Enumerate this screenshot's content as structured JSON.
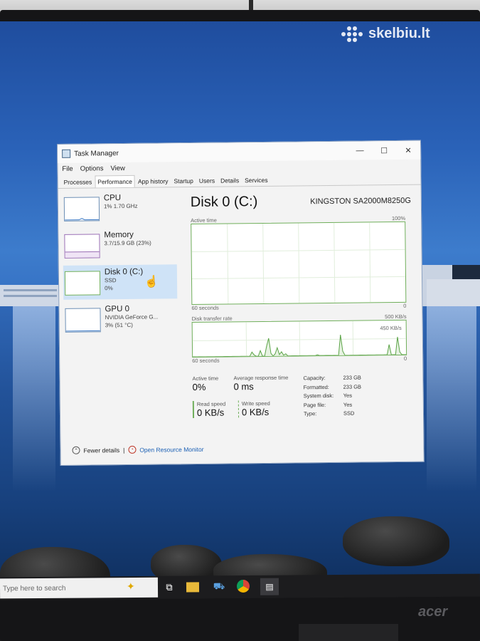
{
  "watermark": "skelbiu.lt",
  "window": {
    "title": "Task Manager",
    "controls": {
      "minimize": "—",
      "maximize": "☐",
      "close": "✕"
    },
    "menu": [
      "File",
      "Options",
      "View"
    ],
    "tabs": [
      "Processes",
      "Performance",
      "App history",
      "Startup",
      "Users",
      "Details",
      "Services"
    ],
    "active_tab": "Performance"
  },
  "resources": [
    {
      "name": "CPU",
      "line1": "1% 1.70 GHz",
      "line2": ""
    },
    {
      "name": "Memory",
      "line1": "3.7/15.9 GB (23%)",
      "line2": ""
    },
    {
      "name": "Disk 0 (C:)",
      "line1": "SSD",
      "line2": "0%"
    },
    {
      "name": "GPU 0",
      "line1": "NVIDIA GeForce G...",
      "line2": "3% (51 °C)"
    }
  ],
  "detail": {
    "title": "Disk 0 (C:)",
    "model": "KINGSTON SA2000M8250G",
    "active_time_graph": {
      "label": "Active time",
      "max": "100%",
      "time_left": "60 seconds",
      "min": "0"
    },
    "transfer_graph": {
      "label": "Disk transfer rate",
      "max": "500 KB/s",
      "marker": "450 KB/s",
      "time_left": "60 seconds",
      "min": "0",
      "rates_kbps": [
        0,
        0,
        0,
        0,
        0,
        0,
        0,
        0,
        0,
        0,
        0,
        0,
        0,
        0,
        0,
        0,
        0,
        0,
        0,
        0,
        0,
        0,
        0,
        0,
        0,
        0,
        0,
        0,
        60,
        20,
        0,
        0,
        80,
        0,
        0,
        150,
        260,
        40,
        0,
        30,
        120,
        20,
        60,
        10,
        30,
        0,
        0,
        0,
        0,
        0,
        0,
        0,
        0,
        0,
        0,
        0,
        0,
        0,
        0,
        10,
        0,
        0,
        0,
        0,
        0,
        0,
        0,
        0,
        0,
        0,
        300,
        60,
        0,
        0,
        0,
        0,
        0,
        0,
        0,
        0,
        0,
        0,
        0,
        0,
        0,
        0,
        0,
        0,
        0,
        0,
        0,
        0,
        0,
        150,
        0,
        0,
        0,
        260,
        40,
        0,
        0,
        0
      ]
    },
    "stats": {
      "active_time_label": "Active time",
      "active_time": "0%",
      "avg_response_label": "Average response time",
      "avg_response": "0 ms",
      "read_label": "Read speed",
      "read": "0 KB/s",
      "write_label": "Write speed",
      "write": "0 KB/s"
    },
    "props": [
      {
        "k": "Capacity:",
        "v": "233 GB"
      },
      {
        "k": "Formatted:",
        "v": "233 GB"
      },
      {
        "k": "System disk:",
        "v": "Yes"
      },
      {
        "k": "Page file:",
        "v": "Yes"
      },
      {
        "k": "Type:",
        "v": "SSD"
      }
    ]
  },
  "footer": {
    "fewer": "Fewer details",
    "separator": "|",
    "monitor": "Open Resource Monitor"
  },
  "taskbar": {
    "search_placeholder": "Type here to search"
  },
  "monitor_brand": "acer"
}
